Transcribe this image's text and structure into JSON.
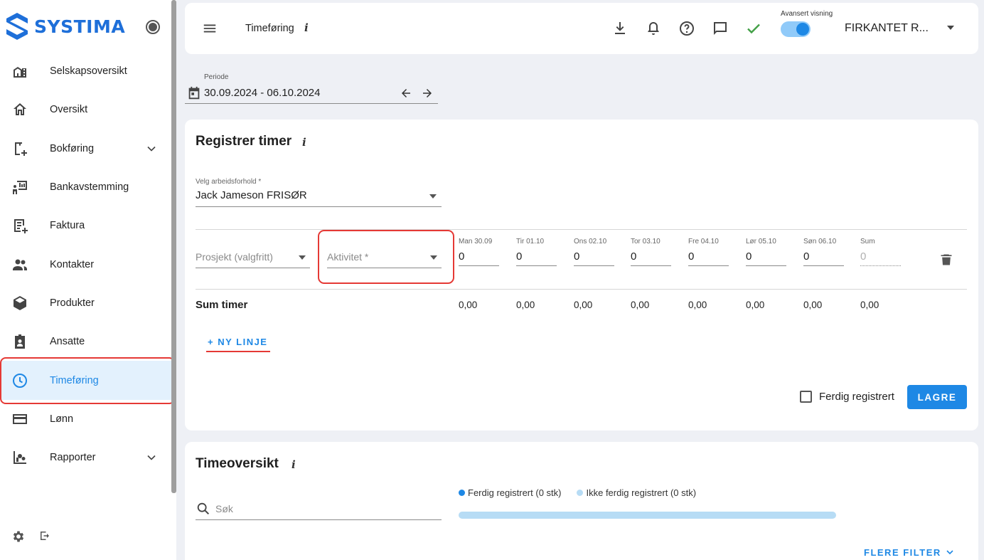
{
  "app": {
    "brand": "SYSTIMA",
    "brand_color": "#1e6fd9",
    "accent_color": "#1e88e5",
    "highlight_color": "#e53935"
  },
  "sidebar": {
    "items": [
      {
        "label": "Selskapsoversikt",
        "icon": "company-overview-icon"
      },
      {
        "label": "Oversikt",
        "icon": "home-icon"
      },
      {
        "label": "Bokføring",
        "icon": "bookkeeping-icon",
        "expandable": true
      },
      {
        "label": "Bankavstemming",
        "icon": "bank-reconciliation-icon"
      },
      {
        "label": "Faktura",
        "icon": "invoice-icon"
      },
      {
        "label": "Kontakter",
        "icon": "contacts-icon"
      },
      {
        "label": "Produkter",
        "icon": "products-icon"
      },
      {
        "label": "Ansatte",
        "icon": "employees-icon"
      },
      {
        "label": "Timeføring",
        "icon": "clock-icon",
        "active": true
      },
      {
        "label": "Lønn",
        "icon": "payroll-icon"
      },
      {
        "label": "Rapporter",
        "icon": "reports-icon",
        "expandable": true
      }
    ]
  },
  "topbar": {
    "title": "Timeføring",
    "info": "i",
    "toggle_label": "Avansert visning",
    "toggle_on": true,
    "company": "FIRKANTET R..."
  },
  "period": {
    "label": "Periode",
    "value": "30.09.2024 - 06.10.2024"
  },
  "register": {
    "title": "Registrer timer",
    "info": "i",
    "employment_label": "Velg arbeidsforhold *",
    "employment_value": "Jack Jameson FRISØR",
    "project_placeholder": "Prosjekt (valgfritt)",
    "activity_placeholder": "Aktivitet *",
    "days": [
      {
        "label": "Man 30.09",
        "value": "0"
      },
      {
        "label": "Tir 01.10",
        "value": "0"
      },
      {
        "label": "Ons 02.10",
        "value": "0"
      },
      {
        "label": "Tor 03.10",
        "value": "0"
      },
      {
        "label": "Fre 04.10",
        "value": "0"
      },
      {
        "label": "Lør 05.10",
        "value": "0"
      },
      {
        "label": "Søn 06.10",
        "value": "0"
      },
      {
        "label": "Sum",
        "value": "0"
      }
    ],
    "sum_label": "Sum timer",
    "sums": [
      "0,00",
      "0,00",
      "0,00",
      "0,00",
      "0,00",
      "0,00",
      "0,00",
      "0,00"
    ],
    "new_line": "+ NY LINJE",
    "done_label": "Ferdig registrert",
    "save_label": "LAGRE"
  },
  "overview": {
    "title": "Timeoversikt",
    "info": "i",
    "search_placeholder": "Søk",
    "legend_done": "Ferdig registrert (0 stk)",
    "legend_not_done": "Ikke ferdig registrert (0 stk)",
    "done_color": "#1e88e5",
    "not_done_color": "#b7dcf5",
    "done_fraction": 0,
    "more_filters": "FLERE FILTER"
  }
}
